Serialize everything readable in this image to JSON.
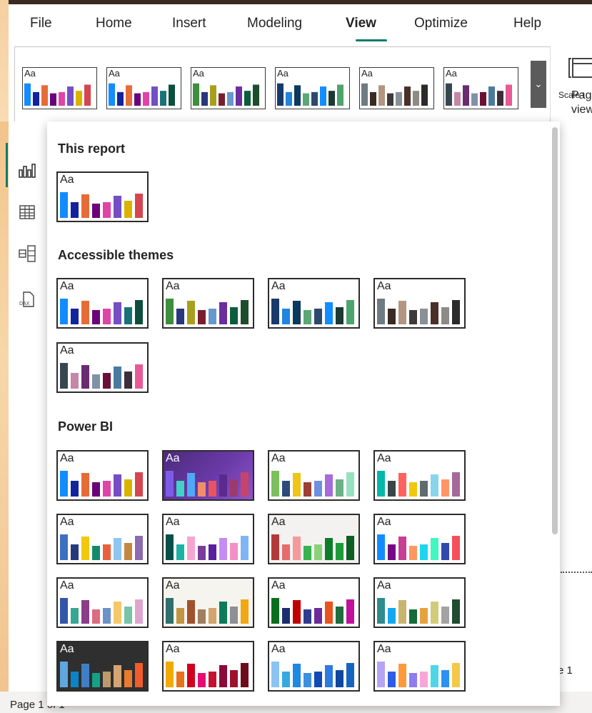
{
  "menu": {
    "items": [
      "File",
      "Home",
      "Insert",
      "Modeling",
      "View",
      "Optimize",
      "Help"
    ],
    "active": "View"
  },
  "ribbon": {
    "more_icon": "chevron-down-icon",
    "page_view_label_line1": "Pag",
    "page_view_label_line2": "view",
    "scale_label": "Scale t",
    "gallery": [
      {
        "aa": "Aa",
        "bg": "#ffffff",
        "fg": "#252423",
        "colors": [
          "#118DFF",
          "#12239E",
          "#E66C37",
          "#6B007B",
          "#E044A7",
          "#744EC2",
          "#D9B300",
          "#D64550"
        ]
      },
      {
        "aa": "Aa",
        "bg": "#ffffff",
        "fg": "#252423",
        "colors": [
          "#118DFF",
          "#12239E",
          "#E66C37",
          "#6B007B",
          "#E044A7",
          "#744EC2",
          "#197278",
          "#0B4F3C"
        ]
      },
      {
        "aa": "Aa",
        "bg": "#ffffff",
        "fg": "#252423",
        "colors": [
          "#3F8E3B",
          "#293680",
          "#A89F1E",
          "#7A1E2E",
          "#6699CC",
          "#6B2E9E",
          "#0B5E3C",
          "#1E4D2B"
        ]
      },
      {
        "aa": "Aa",
        "bg": "#ffffff",
        "fg": "#252423",
        "colors": [
          "#183A6B",
          "#1F85DE",
          "#0B3B5C",
          "#5BA775",
          "#2D4A6E",
          "#118DFF",
          "#1C3A33",
          "#4CA46E"
        ]
      },
      {
        "aa": "Aa",
        "bg": "#ffffff",
        "fg": "#252423",
        "colors": [
          "#6E7B82",
          "#3B2A24",
          "#B49581",
          "#3D3A3A",
          "#899096",
          "#4A3027",
          "#8E8A86",
          "#2B2B2B"
        ]
      },
      {
        "aa": "Aa",
        "bg": "#ffffff",
        "fg": "#252423",
        "colors": [
          "#37474F",
          "#C586A8",
          "#6A2C70",
          "#7F93A6",
          "#6C0F36",
          "#4A7B9D",
          "#3B2E3A",
          "#E85A96"
        ]
      }
    ]
  },
  "nav": {
    "icons": [
      "report-view-icon",
      "table-view-icon",
      "model-view-icon",
      "dax-query-icon"
    ]
  },
  "dropdown": {
    "sections": [
      {
        "title": "This report",
        "themes": [
          {
            "aa": "Aa",
            "bg": "#ffffff",
            "fg": "#252423",
            "colors": [
              "#118DFF",
              "#12239E",
              "#E66C37",
              "#6B007B",
              "#E044A7",
              "#744EC2",
              "#D9B300",
              "#D64550"
            ]
          }
        ]
      },
      {
        "title": "Accessible themes",
        "themes": [
          {
            "aa": "Aa",
            "bg": "#ffffff",
            "fg": "#252423",
            "colors": [
              "#118DFF",
              "#12239E",
              "#E66C37",
              "#6B007B",
              "#E044A7",
              "#744EC2",
              "#197278",
              "#0B4F3C"
            ]
          },
          {
            "aa": "Aa",
            "bg": "#ffffff",
            "fg": "#252423",
            "colors": [
              "#3F8E3B",
              "#293680",
              "#A89F1E",
              "#7A1E2E",
              "#6699CC",
              "#6B2E9E",
              "#0B5E3C",
              "#1E4D2B"
            ]
          },
          {
            "aa": "Aa",
            "bg": "#ffffff",
            "fg": "#252423",
            "colors": [
              "#183A6B",
              "#1F85DE",
              "#0B3B5C",
              "#5BA775",
              "#2D4A6E",
              "#118DFF",
              "#1C3A33",
              "#4CA46E"
            ]
          },
          {
            "aa": "Aa",
            "bg": "#ffffff",
            "fg": "#252423",
            "colors": [
              "#6E7B82",
              "#3B2A24",
              "#B49581",
              "#3D3A3A",
              "#899096",
              "#4A3027",
              "#8E8A86",
              "#2B2B2B"
            ]
          },
          {
            "aa": "Aa",
            "bg": "#ffffff",
            "fg": "#252423",
            "colors": [
              "#37474F",
              "#C586A8",
              "#6A2C70",
              "#7F93A6",
              "#6C0F36",
              "#4A7B9D",
              "#3B2E3A",
              "#E85A96"
            ]
          }
        ]
      },
      {
        "title": "Power BI",
        "themes": [
          {
            "aa": "Aa",
            "bg": "#ffffff",
            "fg": "#252423",
            "colors": [
              "#118DFF",
              "#12239E",
              "#E66C37",
              "#6B007B",
              "#E044A7",
              "#744EC2",
              "#D9B300",
              "#D64550"
            ]
          },
          {
            "aa": "Aa",
            "bg": "gradient-purple",
            "fg": "#ffffff",
            "colors": [
              "#7C5CE6",
              "#3FD3C5",
              "#4EA8F5",
              "#F28C6B",
              "#E8535E",
              "#5A2A8E",
              "#9C3A6E",
              "#C6446A"
            ]
          },
          {
            "aa": "Aa",
            "bg": "#ffffff",
            "fg": "#252423",
            "colors": [
              "#7CBF5D",
              "#2E4A7A",
              "#F0C419",
              "#9C3F35",
              "#6E8FE0",
              "#A66BDB",
              "#6AB187",
              "#98E0C0"
            ]
          },
          {
            "aa": "Aa",
            "bg": "#ffffff",
            "fg": "#252423",
            "colors": [
              "#01B8AA",
              "#374649",
              "#FD625E",
              "#F2C80F",
              "#5F6B6D",
              "#8AD4EB",
              "#FE9666",
              "#A66999"
            ]
          },
          {
            "aa": "Aa",
            "bg": "#ffffff",
            "fg": "#252423",
            "colors": [
              "#3C70C2",
              "#27397A",
              "#F2C80F",
              "#158A6A",
              "#E8603C",
              "#8FC5F0",
              "#C68642",
              "#8E6AB0"
            ]
          },
          {
            "aa": "Aa",
            "bg": "#ffffff",
            "fg": "#252423",
            "colors": [
              "#0B4F4A",
              "#1DB3A4",
              "#F6A5D1",
              "#7A3C9A",
              "#5A1F9E",
              "#C48DF3",
              "#F28FC6",
              "#7EB6F5"
            ]
          },
          {
            "aa": "Aa",
            "bg": "#f3f2f1",
            "fg": "#252423",
            "colors": [
              "#B33A3A",
              "#E66C6C",
              "#F59A9A",
              "#36B24E",
              "#8BD17C",
              "#0D7D2A",
              "#1D9A3B",
              "#0F5E22"
            ]
          },
          {
            "aa": "Aa",
            "bg": "#ffffff",
            "fg": "#252423",
            "colors": [
              "#118DFF",
              "#750985",
              "#C83D95",
              "#FF985E",
              "#1DD5EE",
              "#42F7C0",
              "#3049AD",
              "#F64F5C"
            ]
          },
          {
            "aa": "Aa",
            "bg": "#ffffff",
            "fg": "#252423",
            "colors": [
              "#3257A8",
              "#37A794",
              "#8B3D88",
              "#DD6B7F",
              "#6B91C9",
              "#F5C869",
              "#77C4A8",
              "#DEA6CF"
            ]
          },
          {
            "aa": "Aa",
            "bg": "#f6f4ee",
            "fg": "#252423",
            "colors": [
              "#2F6F6C",
              "#C29542",
              "#A0522D",
              "#9F7F60",
              "#D1A56B",
              "#0E7A5A",
              "#8C8F93",
              "#F3A712"
            ]
          },
          {
            "aa": "Aa",
            "bg": "#ffffff",
            "fg": "#252423",
            "colors": [
              "#0A6E1D",
              "#1B2E6E",
              "#C00000",
              "#2D3E8F",
              "#6D2B9A",
              "#E8531E",
              "#1C6E3E",
              "#C0119A"
            ]
          },
          {
            "aa": "Aa",
            "bg": "#ffffff",
            "fg": "#252423",
            "colors": [
              "#2F8C8C",
              "#11A8F2",
              "#C8B46E",
              "#156B3A",
              "#E6A23C",
              "#D4CB79",
              "#A3A3A3",
              "#1F4D2E"
            ]
          },
          {
            "aa": "Aa",
            "bg": "#2f2f2f",
            "fg": "#ffffff",
            "colors": [
              "#5EA7E0",
              "#0B84C7",
              "#3F7FC4",
              "#16A085",
              "#BE9A6B",
              "#D4A574",
              "#EA7B2C",
              "#F25C2A"
            ]
          },
          {
            "aa": "Aa",
            "bg": "#ffffff",
            "fg": "#252423",
            "colors": [
              "#F2A900",
              "#E8711A",
              "#D1001F",
              "#E60B72",
              "#C8102E",
              "#8B0A39",
              "#A0102E",
              "#6D0A1B"
            ]
          },
          {
            "aa": "Aa",
            "bg": "#ffffff",
            "fg": "#252423",
            "colors": [
              "#8AC4F2",
              "#36A9E1",
              "#1E88E5",
              "#3F8FE0",
              "#114AB5",
              "#2B7BE0",
              "#0D47A1",
              "#1565C0"
            ]
          },
          {
            "aa": "Aa",
            "bg": "#ffffff",
            "fg": "#252423",
            "colors": [
              "#B6A3F5",
              "#2E5CE6",
              "#FF9A3C",
              "#8E7CF0",
              "#F7A6D6",
              "#4ED5E8",
              "#2B91F2",
              "#F5C84A"
            ]
          }
        ]
      }
    ]
  },
  "canvas": {
    "page_right_label": "e 1"
  },
  "status": {
    "page_indicator": "Page 1 of 1"
  }
}
